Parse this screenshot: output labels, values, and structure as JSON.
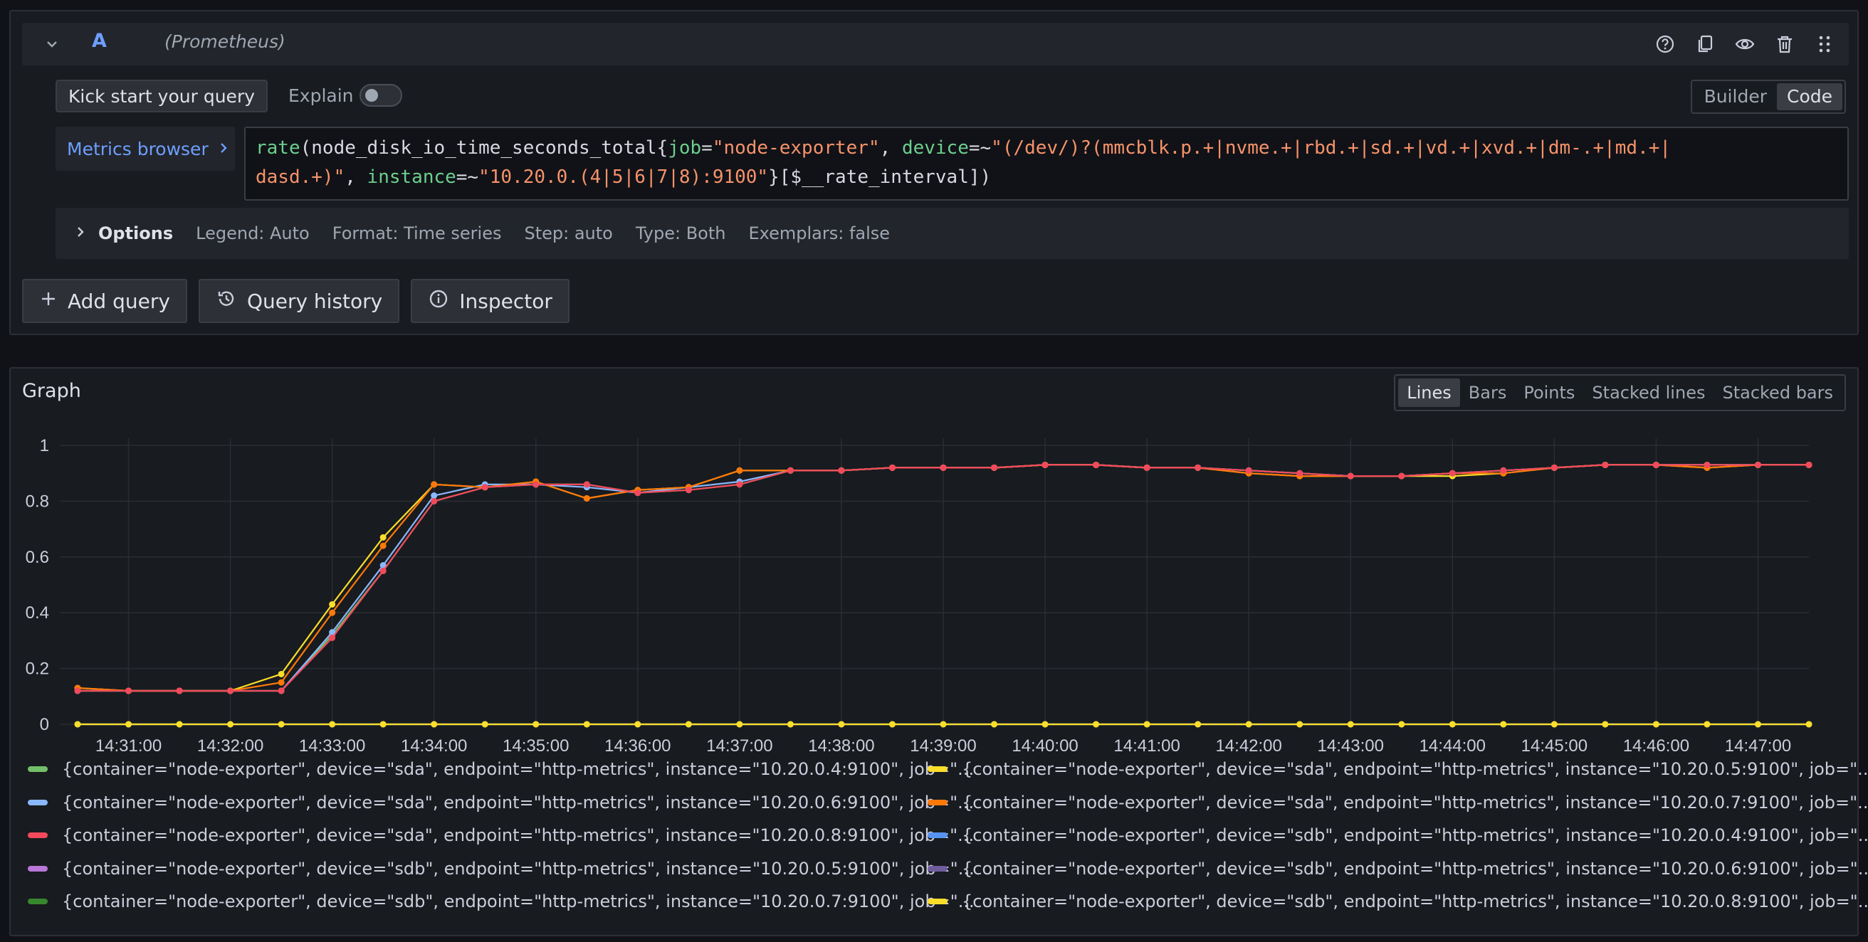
{
  "query": {
    "letter": "A",
    "datasource": "(Prometheus)",
    "kick_start_label": "Kick start your query",
    "explain_label": "Explain",
    "modes": [
      "Builder",
      "Code"
    ],
    "active_mode": "Code",
    "metrics_browser_label": "Metrics browser",
    "code_line1": [
      {
        "t": "fn",
        "s": "rate"
      },
      {
        "t": "op",
        "s": "(node_disk_io_time_seconds_total{"
      },
      {
        "t": "lbl",
        "s": "job"
      },
      {
        "t": "op",
        "s": "="
      },
      {
        "t": "str",
        "s": "\"node-exporter\""
      },
      {
        "t": "op",
        "s": ", "
      },
      {
        "t": "lbl",
        "s": "device"
      },
      {
        "t": "op",
        "s": "=~"
      },
      {
        "t": "str",
        "s": "\"(/dev/)?(mmcblk.p.+|nvme.+|rbd.+|sd.+|vd.+|xvd.+|dm-.+|md.+|"
      }
    ],
    "code_line2": [
      {
        "t": "str",
        "s": "dasd.+)\""
      },
      {
        "t": "op",
        "s": ", "
      },
      {
        "t": "lbl",
        "s": "instance"
      },
      {
        "t": "op",
        "s": "=~"
      },
      {
        "t": "str",
        "s": "\"10.20.0.(4|5|6|7|8):9100\""
      },
      {
        "t": "op",
        "s": "}[$__rate_interval])"
      }
    ],
    "options": {
      "title": "Options",
      "legend": "Legend: Auto",
      "format": "Format: Time series",
      "step": "Step: auto",
      "type": "Type: Both",
      "exemplars": "Exemplars: false"
    },
    "buttons": {
      "add_query": "Add query",
      "query_history": "Query history",
      "inspector": "Inspector"
    }
  },
  "graph": {
    "title": "Graph",
    "styles": [
      "Lines",
      "Bars",
      "Points",
      "Stacked lines",
      "Stacked bars"
    ],
    "active_style": "Lines"
  },
  "chart_data": {
    "type": "line",
    "x": [
      "14:30:30",
      "14:31:00",
      "14:31:30",
      "14:32:00",
      "14:32:30",
      "14:33:00",
      "14:33:30",
      "14:34:00",
      "14:34:30",
      "14:35:00",
      "14:35:30",
      "14:36:00",
      "14:36:30",
      "14:37:00",
      "14:37:30",
      "14:38:00",
      "14:38:30",
      "14:39:00",
      "14:39:30",
      "14:40:00",
      "14:40:30",
      "14:41:00",
      "14:41:30",
      "14:42:00",
      "14:42:30",
      "14:43:00",
      "14:43:30",
      "14:44:00",
      "14:44:30",
      "14:45:00",
      "14:45:30",
      "14:46:00",
      "14:46:30",
      "14:47:00",
      "14:47:30"
    ],
    "x_ticks": [
      "14:31:00",
      "14:32:00",
      "14:33:00",
      "14:34:00",
      "14:35:00",
      "14:36:00",
      "14:37:00",
      "14:38:00",
      "14:39:00",
      "14:40:00",
      "14:41:00",
      "14:42:00",
      "14:43:00",
      "14:44:00",
      "14:45:00",
      "14:46:00",
      "14:47:00"
    ],
    "y_ticks": [
      "0",
      "0.2",
      "0.4",
      "0.6",
      "0.8",
      "1"
    ],
    "ylim": [
      0,
      1
    ],
    "grid": true,
    "legend_position": "bottom",
    "series": [
      {
        "name": "{container=\"node-exporter\", device=\"sda\", endpoint=\"http-metrics\", instance=\"10.20.0.4:9100\", job=\"...",
        "color": "#73bf69",
        "values": [
          0.12,
          0.12,
          0.12,
          0.12,
          0.12,
          0.32,
          0.55,
          0.8,
          0.85,
          0.86,
          0.86,
          0.83,
          0.84,
          0.86,
          0.91,
          0.91,
          0.92,
          0.92,
          0.92,
          0.93,
          0.93,
          0.92,
          0.92,
          0.91,
          0.9,
          0.89,
          0.89,
          0.9,
          0.91,
          0.92,
          0.93,
          0.93,
          0.93,
          0.93,
          0.93
        ]
      },
      {
        "name": "{container=\"node-exporter\", device=\"sda\", endpoint=\"http-metrics\", instance=\"10.20.0.5:9100\", job=\"...",
        "color": "#fade2a",
        "values": [
          0.13,
          0.12,
          0.12,
          0.12,
          0.18,
          0.43,
          0.67,
          0.86,
          0.85,
          0.87,
          0.81,
          0.84,
          0.85,
          0.91,
          0.91,
          0.91,
          0.92,
          0.92,
          0.92,
          0.93,
          0.93,
          0.92,
          0.92,
          0.9,
          0.89,
          0.89,
          0.89,
          0.89,
          0.9,
          0.92,
          0.93,
          0.93,
          0.92,
          0.93,
          0.93
        ]
      },
      {
        "name": "{container=\"node-exporter\", device=\"sda\", endpoint=\"http-metrics\", instance=\"10.20.0.6:9100\", job=\"...",
        "color": "#8ab8ff",
        "values": [
          0.12,
          0.12,
          0.12,
          0.12,
          0.12,
          0.33,
          0.57,
          0.82,
          0.86,
          0.86,
          0.85,
          0.83,
          0.85,
          0.87,
          0.91,
          0.91,
          0.92,
          0.92,
          0.92,
          0.93,
          0.93,
          0.92,
          0.92,
          0.91,
          0.9,
          0.89,
          0.89,
          0.9,
          0.91,
          0.92,
          0.93,
          0.93,
          0.93,
          0.93,
          0.93
        ]
      },
      {
        "name": "{container=\"node-exporter\", device=\"sda\", endpoint=\"http-metrics\", instance=\"10.20.0.7:9100\", job=\"...",
        "color": "#ff780a",
        "values": [
          0.13,
          0.12,
          0.12,
          0.12,
          0.15,
          0.4,
          0.64,
          0.86,
          0.85,
          0.87,
          0.81,
          0.84,
          0.85,
          0.91,
          0.91,
          0.91,
          0.92,
          0.92,
          0.92,
          0.93,
          0.93,
          0.92,
          0.92,
          0.9,
          0.89,
          0.89,
          0.89,
          0.9,
          0.9,
          0.92,
          0.93,
          0.93,
          0.92,
          0.93,
          0.93
        ]
      },
      {
        "name": "{container=\"node-exporter\", device=\"sda\", endpoint=\"http-metrics\", instance=\"10.20.0.8:9100\", job=\"...",
        "color": "#f2495c",
        "values": [
          0.12,
          0.12,
          0.12,
          0.12,
          0.12,
          0.31,
          0.55,
          0.8,
          0.85,
          0.86,
          0.86,
          0.83,
          0.84,
          0.86,
          0.91,
          0.91,
          0.92,
          0.92,
          0.92,
          0.93,
          0.93,
          0.92,
          0.92,
          0.91,
          0.9,
          0.89,
          0.89,
          0.9,
          0.91,
          0.92,
          0.93,
          0.93,
          0.93,
          0.93,
          0.93
        ]
      },
      {
        "name": "{container=\"node-exporter\", device=\"sdb\", endpoint=\"http-metrics\", instance=\"10.20.0.4:9100\", job=\"...",
        "color": "#5794f2",
        "values": [
          0,
          0,
          0,
          0,
          0,
          0,
          0,
          0,
          0,
          0,
          0,
          0,
          0,
          0,
          0,
          0,
          0,
          0,
          0,
          0,
          0,
          0,
          0,
          0,
          0,
          0,
          0,
          0,
          0,
          0,
          0,
          0,
          0,
          0,
          0
        ]
      },
      {
        "name": "{container=\"node-exporter\", device=\"sdb\", endpoint=\"http-metrics\", instance=\"10.20.0.5:9100\", job=\"...",
        "color": "#b877d9",
        "values": [
          0,
          0,
          0,
          0,
          0,
          0,
          0,
          0,
          0,
          0,
          0,
          0,
          0,
          0,
          0,
          0,
          0,
          0,
          0,
          0,
          0,
          0,
          0,
          0,
          0,
          0,
          0,
          0,
          0,
          0,
          0,
          0,
          0,
          0,
          0
        ]
      },
      {
        "name": "{container=\"node-exporter\", device=\"sdb\", endpoint=\"http-metrics\", instance=\"10.20.0.6:9100\", job=\"...",
        "color": "#705da0",
        "values": [
          0,
          0,
          0,
          0,
          0,
          0,
          0,
          0,
          0,
          0,
          0,
          0,
          0,
          0,
          0,
          0,
          0,
          0,
          0,
          0,
          0,
          0,
          0,
          0,
          0,
          0,
          0,
          0,
          0,
          0,
          0,
          0,
          0,
          0,
          0
        ]
      },
      {
        "name": "{container=\"node-exporter\", device=\"sdb\", endpoint=\"http-metrics\", instance=\"10.20.0.7:9100\", job=\"...",
        "color": "#37872d",
        "values": [
          0,
          0,
          0,
          0,
          0,
          0,
          0,
          0,
          0,
          0,
          0,
          0,
          0,
          0,
          0,
          0,
          0,
          0,
          0,
          0,
          0,
          0,
          0,
          0,
          0,
          0,
          0,
          0,
          0,
          0,
          0,
          0,
          0,
          0,
          0
        ]
      },
      {
        "name": "{container=\"node-exporter\", device=\"sdb\", endpoint=\"http-metrics\", instance=\"10.20.0.8:9100\", job=\"...",
        "color": "#fade2a",
        "values": [
          0,
          0,
          0,
          0,
          0,
          0,
          0,
          0,
          0,
          0,
          0,
          0,
          0,
          0,
          0,
          0,
          0,
          0,
          0,
          0,
          0,
          0,
          0,
          0,
          0,
          0,
          0,
          0,
          0,
          0,
          0,
          0,
          0,
          0,
          0
        ]
      }
    ]
  }
}
